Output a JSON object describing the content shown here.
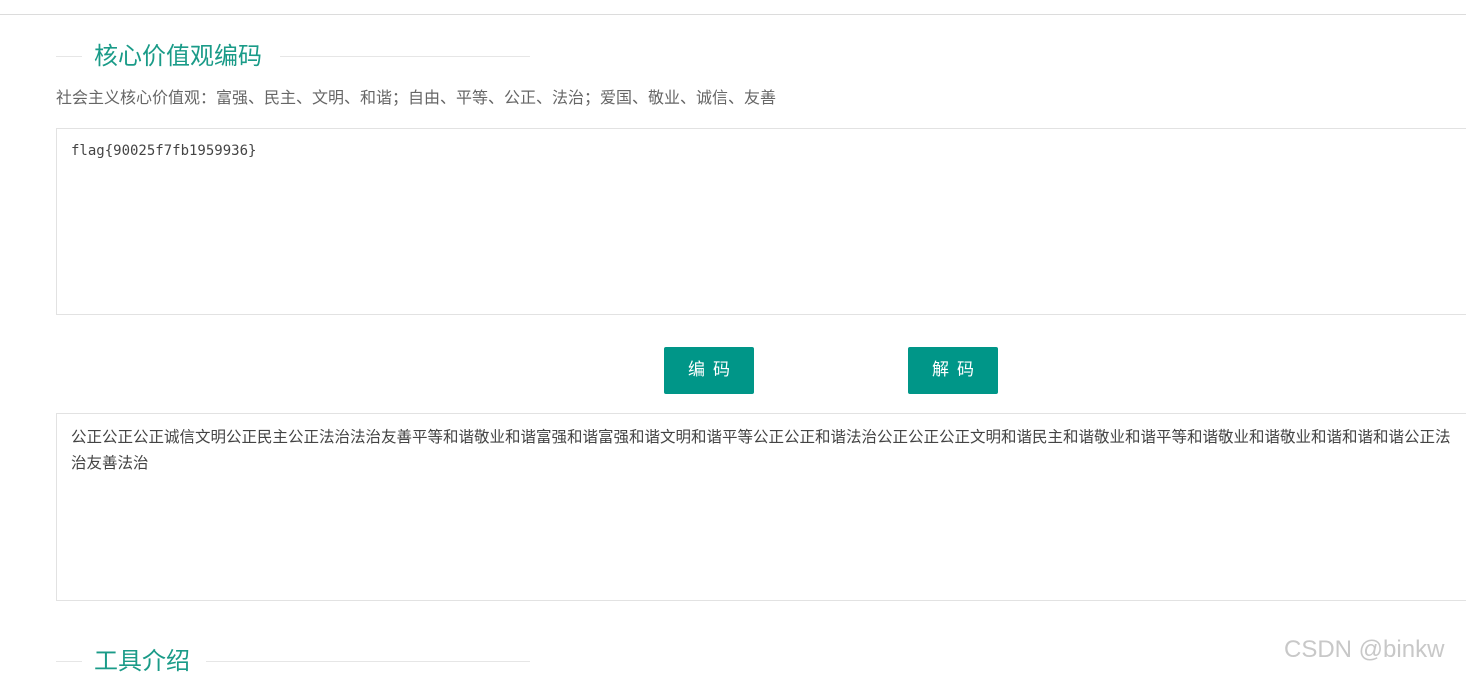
{
  "sections": {
    "encoder": {
      "title": "核心价值观编码",
      "subtitle": "社会主义核心价值观：富强、民主、文明、和谐；自由、平等、公正、法治；爱国、敬业、诚信、友善"
    },
    "intro": {
      "title": "工具介绍"
    }
  },
  "input": {
    "value": "flag{90025f7fb1959936}"
  },
  "buttons": {
    "encode_label": "编码",
    "decode_label": "解码"
  },
  "output": {
    "value": "公正公正公正诚信文明公正民主公正法治法治友善平等和谐敬业和谐富强和谐富强和谐文明和谐平等公正公正和谐法治公正公正公正文明和谐民主和谐敬业和谐平等和谐敬业和谐敬业和谐和谐和谐公正法治友善法治"
  },
  "watermark": "CSDN @binkw"
}
